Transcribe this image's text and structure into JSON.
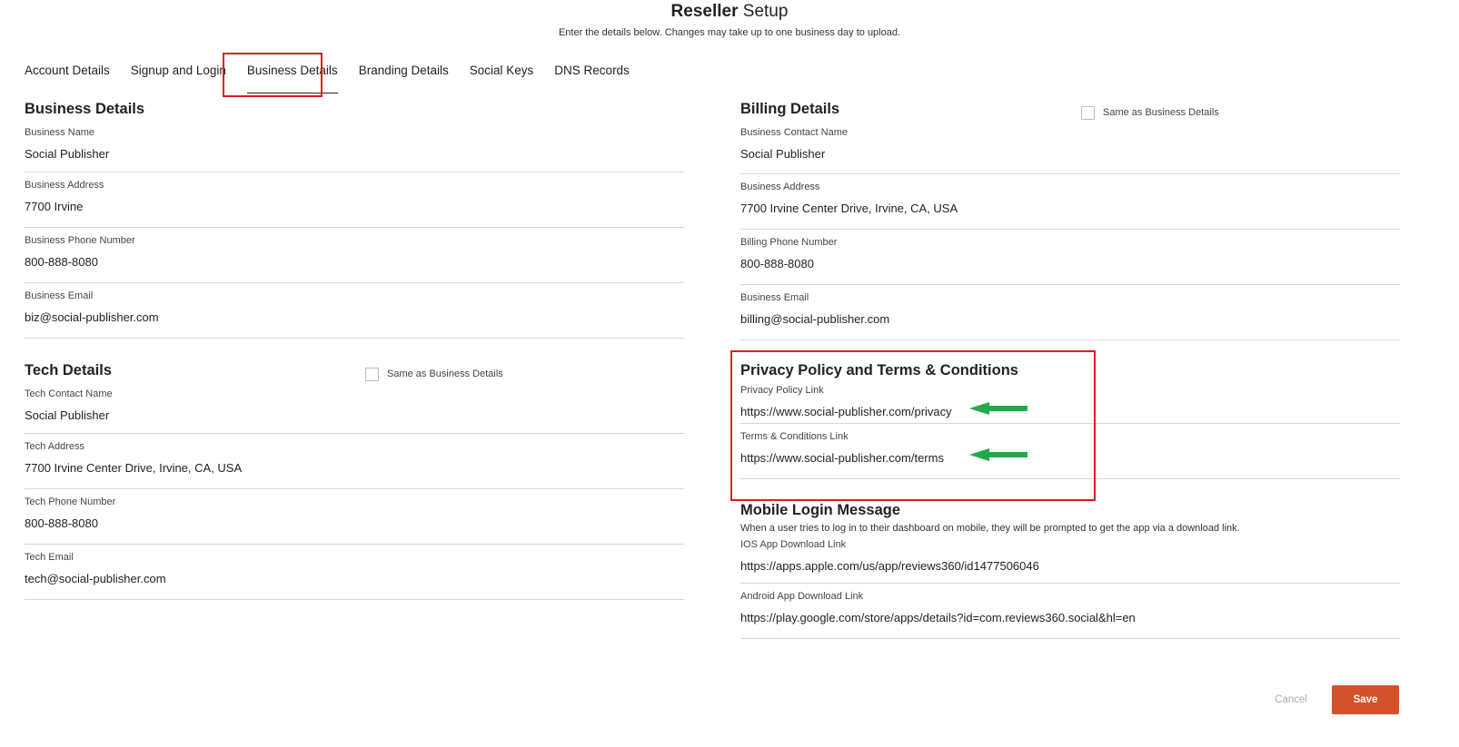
{
  "header": {
    "title_bold": "Reseller",
    "title_rest": " Setup",
    "subtitle": "Enter the details below. Changes may take up to one business day to upload."
  },
  "tabs": [
    {
      "label": "Account Details",
      "active": false
    },
    {
      "label": "Signup and Login",
      "active": false
    },
    {
      "label": "Business Details",
      "active": true
    },
    {
      "label": "Branding Details",
      "active": false
    },
    {
      "label": "Social Keys",
      "active": false
    },
    {
      "label": "DNS Records",
      "active": false
    }
  ],
  "business": {
    "title": "Business Details",
    "fields": [
      {
        "label": "Business Name",
        "value": "Social Publisher"
      },
      {
        "label": "Business Address",
        "value": "7700 Irvine"
      },
      {
        "label": "Business Phone Number",
        "value": "800-888-8080"
      },
      {
        "label": "Business Email",
        "value": "biz@social-publisher.com"
      }
    ]
  },
  "tech": {
    "title": "Tech Details",
    "same_as_label": "Same as Business Details",
    "fields": [
      {
        "label": "Tech Contact Name",
        "value": "Social Publisher"
      },
      {
        "label": "Tech Address",
        "value": "7700 Irvine Center Drive, Irvine, CA, USA"
      },
      {
        "label": "Tech Phone Number",
        "value": "800-888-8080"
      },
      {
        "label": "Tech Email",
        "value": "tech@social-publisher.com"
      }
    ]
  },
  "billing": {
    "title": "Billing Details",
    "same_as_label": "Same as Business Details",
    "fields": [
      {
        "label": "Business Contact Name",
        "value": "Social Publisher"
      },
      {
        "label": "Business Address",
        "value": "7700 Irvine Center Drive, Irvine, CA, USA"
      },
      {
        "label": "Billing Phone Number",
        "value": "800-888-8080"
      },
      {
        "label": "Business Email",
        "value": "billing@social-publisher.com"
      }
    ]
  },
  "privacy": {
    "title": "Privacy Policy and Terms & Conditions",
    "fields": [
      {
        "label": "Privacy Policy Link",
        "value": "https://www.social-publisher.com/privacy"
      },
      {
        "label": "Terms & Conditions Link",
        "value": "https://www.social-publisher.com/terms"
      }
    ]
  },
  "mobile": {
    "title": "Mobile Login Message",
    "description": "When a user tries to log in to their dashboard on mobile, they will be prompted to get the app via a download link.",
    "fields": [
      {
        "label": "IOS App Download Link",
        "value": "https://apps.apple.com/us/app/reviews360/id1477506046"
      },
      {
        "label": "Android App Download Link",
        "value": "https://play.google.com/store/apps/details?id=com.reviews360.social&hl=en"
      }
    ]
  },
  "buttons": {
    "cancel": "Cancel",
    "save": "Save"
  },
  "colors": {
    "annotation_red": "#e4181b",
    "annotation_arrow": "#22a94a",
    "save_button": "#d3522a"
  }
}
